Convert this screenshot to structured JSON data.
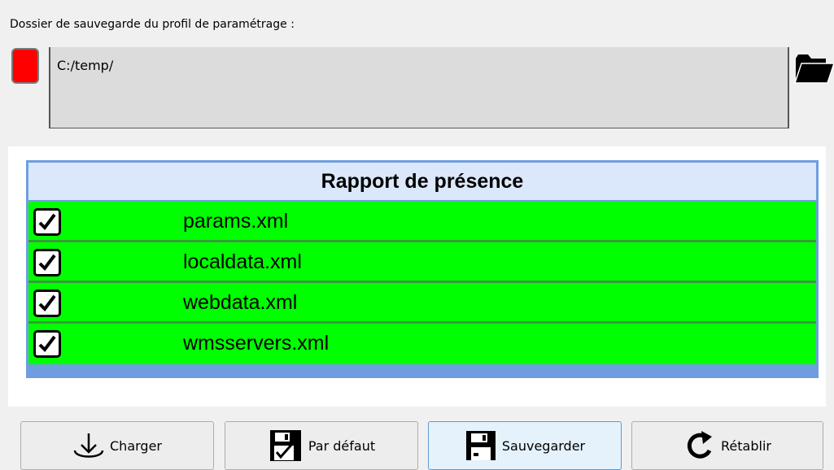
{
  "save_folder": {
    "label": "Dossier de sauvegarde du profil de paramétrage :",
    "path": "C:/temp/",
    "status_color": "#ff0000",
    "browse_icon": "folder-icon"
  },
  "report": {
    "title": "Rapport de présence",
    "row_color": "#00ff00",
    "rows": [
      {
        "file": "params.xml",
        "checked": true
      },
      {
        "file": "localdata.xml",
        "checked": true
      },
      {
        "file": "webdata.xml",
        "checked": true
      },
      {
        "file": "wmsservers.xml",
        "checked": true
      }
    ]
  },
  "actions": {
    "load": {
      "label": "Charger",
      "icon": "download-arrow-icon"
    },
    "default": {
      "label": "Par défaut",
      "icon": "floppy-check-icon"
    },
    "save": {
      "label": "Sauvegarder",
      "icon": "floppy-disk-icon"
    },
    "restore": {
      "label": "Rétablir",
      "icon": "redo-arrow-icon"
    }
  }
}
